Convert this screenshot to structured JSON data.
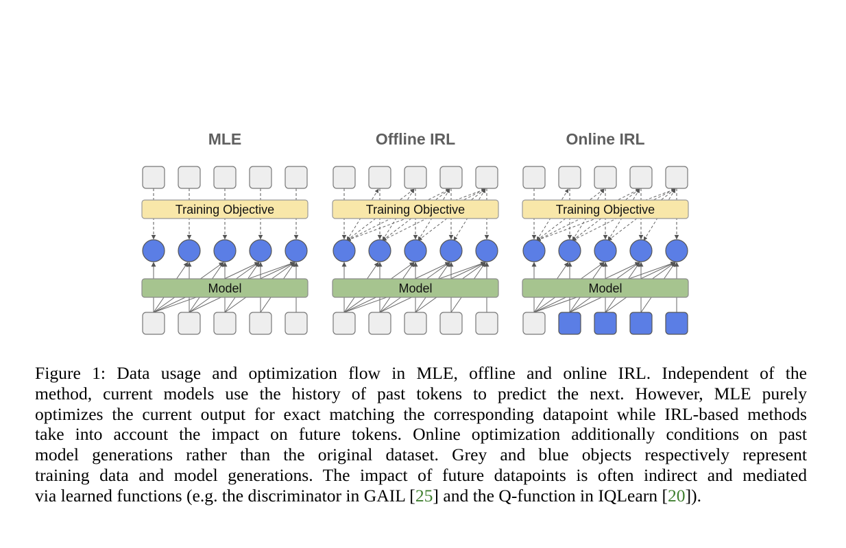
{
  "figure": {
    "panels": [
      {
        "id": "mle",
        "title": "MLE",
        "objective_label": "Training Objective",
        "model_label": "Model",
        "objective_links": "direct",
        "input_types": [
          "data",
          "data",
          "data",
          "data",
          "data"
        ]
      },
      {
        "id": "offline-irl",
        "title": "Offline IRL",
        "objective_label": "Training Objective",
        "model_label": "Model",
        "objective_links": "future",
        "input_types": [
          "data",
          "data",
          "data",
          "data",
          "data"
        ]
      },
      {
        "id": "online-irl",
        "title": "Online IRL",
        "objective_label": "Training Objective",
        "model_label": "Model",
        "objective_links": "future",
        "input_types": [
          "data",
          "generation",
          "generation",
          "generation",
          "generation"
        ]
      }
    ],
    "colors": {
      "data_box": "#eeeeee",
      "generation": "#5b7ee5",
      "objective_bar": "#f8e7a9",
      "model_bar": "#a6c48f",
      "title": "#5f5f5f",
      "stroke": "#666666"
    }
  },
  "caption": {
    "lines": [
      "Figure 1: Data usage and optimization flow in MLE, offline and online IRL. Independent of the",
      "method, current models use the history of past tokens to predict the next. However, MLE purely",
      "optimizes the current output for exact matching the corresponding datapoint while IRL-based methods",
      "take into account the impact on future tokens. Online optimization additionally conditions on past",
      "model generations rather than the original dataset. Grey and blue objects respectively represent",
      "training data and model generations. The impact of future datapoints is often indirect and mediated"
    ],
    "last_line": {
      "part1": "via learned functions (e.g. the discriminator in GAIL [",
      "cite1": "25",
      "part2": "] and the Q-function in IQLearn [",
      "cite2": "20",
      "part3": "])."
    },
    "cite_color": "#3f7f2f"
  }
}
